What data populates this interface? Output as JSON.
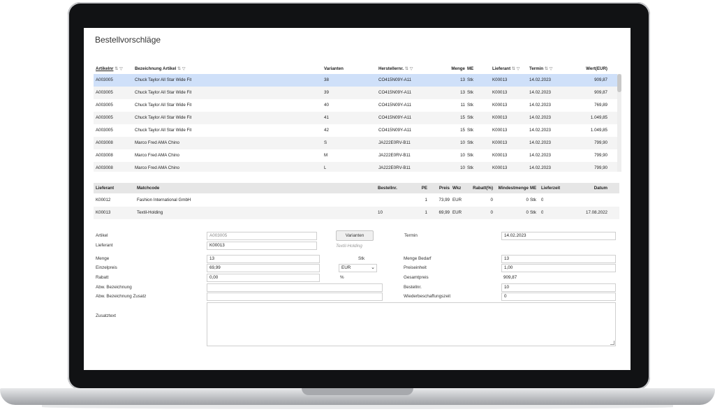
{
  "page": {
    "title": "Bestellvorschläge"
  },
  "orders": {
    "columns": {
      "artikelnr": "Artikelnr",
      "bezeichnung": "Bezeichnung Artikel",
      "varianten": "Varianten",
      "herstellernr": "Herstellernr.",
      "menge": "Menge",
      "me": "ME",
      "lieferant": "Lieferant",
      "termin": "Termin",
      "wert": "Wert(EUR)"
    },
    "rows": [
      {
        "artikelnr": "A003005",
        "bezeichnung": "Chuck Taylor All Star Wide Fit",
        "varianten": "38",
        "herstellernr": "CO415N09Y-A11",
        "menge": "13",
        "me": "Stk",
        "lieferant": "K00013",
        "termin": "14.02.2023",
        "wert": "909,87",
        "selected": true
      },
      {
        "artikelnr": "A003005",
        "bezeichnung": "Chuck Taylor All Star Wide Fit",
        "varianten": "39",
        "herstellernr": "CO415N09Y-A11",
        "menge": "13",
        "me": "Stk",
        "lieferant": "K00013",
        "termin": "14.02.2023",
        "wert": "909,87"
      },
      {
        "artikelnr": "A003005",
        "bezeichnung": "Chuck Taylor All Star Wide Fit",
        "varianten": "40",
        "herstellernr": "CO415N09Y-A11",
        "menge": "11",
        "me": "Stk",
        "lieferant": "K00013",
        "termin": "14.02.2023",
        "wert": "769,89"
      },
      {
        "artikelnr": "A003005",
        "bezeichnung": "Chuck Taylor All Star Wide Fit",
        "varianten": "41",
        "herstellernr": "CO415N09Y-A11",
        "menge": "15",
        "me": "Stk",
        "lieferant": "K00013",
        "termin": "14.02.2023",
        "wert": "1.049,85"
      },
      {
        "artikelnr": "A003005",
        "bezeichnung": "Chuck Taylor All Star Wide Fit",
        "varianten": "42",
        "herstellernr": "CO415N09Y-A11",
        "menge": "15",
        "me": "Stk",
        "lieferant": "K00013",
        "termin": "14.02.2023",
        "wert": "1.049,85"
      },
      {
        "artikelnr": "A003008",
        "bezeichnung": "Marco Fred AMA Chino",
        "varianten": "S",
        "herstellernr": "JA222E0RV-B11",
        "menge": "10",
        "me": "Stk",
        "lieferant": "K00013",
        "termin": "14.02.2023",
        "wert": "799,90"
      },
      {
        "artikelnr": "A003008",
        "bezeichnung": "Marco Fred AMA Chino",
        "varianten": "M",
        "herstellernr": "JA222E0RV-B11",
        "menge": "10",
        "me": "Stk",
        "lieferant": "K00013",
        "termin": "14.02.2023",
        "wert": "799,90"
      },
      {
        "artikelnr": "A003008",
        "bezeichnung": "Marco Fred AMA Chino",
        "varianten": "L",
        "herstellernr": "JA222E0RV-B11",
        "menge": "10",
        "me": "Stk",
        "lieferant": "K00013",
        "termin": "14.02.2023",
        "wert": "799,90"
      }
    ]
  },
  "suppliers": {
    "columns": {
      "lieferant": "Lieferant",
      "matchcode": "Matchcode",
      "bestellnr": "Bestellnr.",
      "pe": "PE",
      "preis": "Preis",
      "wkz": "Wkz",
      "rabatt": "Rabatt(%)",
      "mindestmenge": "Mindestmenge",
      "me": "ME",
      "lieferzeit": "Lieferzeit",
      "datum": "Datum"
    },
    "rows": [
      {
        "lieferant": "K00012",
        "matchcode": "Fashion International GmbH",
        "bestellnr": "",
        "pe": "1",
        "preis": "73,99",
        "wkz": "EUR",
        "rabatt": "0",
        "mindestmenge": "0",
        "me": "Stk",
        "lieferzeit": "0",
        "datum": ""
      },
      {
        "lieferant": "K00013",
        "matchcode": "Textil-Holding",
        "bestellnr": "10",
        "pe": "1",
        "preis": "69,99",
        "wkz": "EUR",
        "rabatt": "0",
        "mindestmenge": "0",
        "me": "Stk",
        "lieferzeit": "0",
        "datum": "17.08.2022"
      }
    ]
  },
  "form": {
    "artikel_label": "Artikel",
    "artikel_value": "A003005",
    "varianten_button": "Varianten",
    "termin_label": "Termin",
    "termin_value": "14.02.2023",
    "lieferant_label": "Lieferant",
    "lieferant_value": "K00013",
    "lieferant_name": "Textil-Holding",
    "menge_label": "Menge",
    "menge_value": "13",
    "menge_unit": "Stk",
    "menge_bedarf_label": "Menge Bedarf",
    "menge_bedarf_value": "13",
    "einzelpreis_label": "Einzelpreis",
    "einzelpreis_value": "69,99",
    "currency_value": "EUR",
    "preiseinheit_label": "Preiseinheit",
    "preiseinheit_value": "1,00",
    "rabatt_label": "Rabatt",
    "rabatt_value": "0,00",
    "rabatt_unit": "%",
    "gesamtpreis_label": "Gesamtpreis",
    "gesamtpreis_value": "909,87",
    "abw_bezeichnung_label": "Abw. Bezeichnung",
    "abw_bezeichnung_value": "",
    "bestellnr_label": "Bestellnr.",
    "bestellnr_value": "10",
    "abw_zusatz_label": "Abw. Bezeichnung Zusatz",
    "abw_zusatz_value": "",
    "wiederbeschaffung_label": "Wiederbeschaffungszeit",
    "wiederbeschaffung_value": "0",
    "zusatztext_label": "Zusatztext",
    "zusatztext_value": ""
  },
  "icons": {
    "sort": "sort-arrows-icon",
    "filter": "filter-icon",
    "dropdown": "chevron-down-icon",
    "resize": "resize-grip-icon"
  },
  "colors": {
    "selected_row": "#cfe0f9",
    "alt_row": "#f4f4f4",
    "header_bg": "#e6e6e6"
  }
}
